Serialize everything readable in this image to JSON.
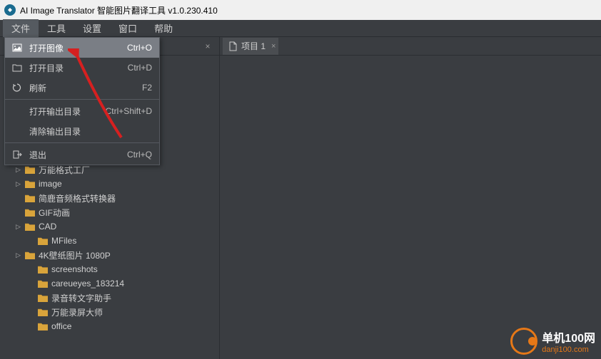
{
  "titlebar": {
    "title": "AI Image Translator 智能图片翻译工具 v1.0.230.410"
  },
  "menubar": {
    "items": [
      "文件",
      "工具",
      "设置",
      "窗口",
      "帮助"
    ]
  },
  "dropdown": {
    "items": [
      {
        "label": "打开图像",
        "shortcut": "Ctrl+O",
        "icon": "image",
        "hover": true
      },
      {
        "label": "打开目录",
        "shortcut": "Ctrl+D",
        "icon": "folder"
      },
      {
        "label": "刷新",
        "shortcut": "F2",
        "icon": "refresh"
      },
      {
        "sep": true
      },
      {
        "label": "打开输出目录",
        "shortcut": "Ctrl+Shift+D",
        "icon": ""
      },
      {
        "label": "清除输出目录",
        "shortcut": "",
        "icon": ""
      },
      {
        "sep": true
      },
      {
        "label": "退出",
        "shortcut": "Ctrl+Q",
        "icon": "exit"
      }
    ]
  },
  "tree": {
    "items": [
      {
        "label": "万能格式工厂",
        "expand": true,
        "indent": 0
      },
      {
        "label": "image",
        "expand": true,
        "indent": 0
      },
      {
        "label": "简鹿音频格式转换器",
        "expand": false,
        "indent": 0
      },
      {
        "label": "GIF动画",
        "expand": false,
        "indent": 0
      },
      {
        "label": "CAD",
        "expand": true,
        "indent": 0
      },
      {
        "label": "MFiles",
        "expand": false,
        "indent": 1
      },
      {
        "label": "4K壁纸图片 1080P",
        "expand": true,
        "indent": 0
      },
      {
        "label": "screenshots",
        "expand": false,
        "indent": 1
      },
      {
        "label": "careueyes_183214",
        "expand": false,
        "indent": 1
      },
      {
        "label": "录音转文字助手",
        "expand": false,
        "indent": 1
      },
      {
        "label": "万能录屏大师",
        "expand": false,
        "indent": 1
      },
      {
        "label": "office",
        "expand": false,
        "indent": 1
      }
    ]
  },
  "tabs": {
    "items": [
      {
        "label": "项目 1"
      }
    ]
  },
  "watermark": {
    "title": "单机100网",
    "url": "danji100.com"
  }
}
